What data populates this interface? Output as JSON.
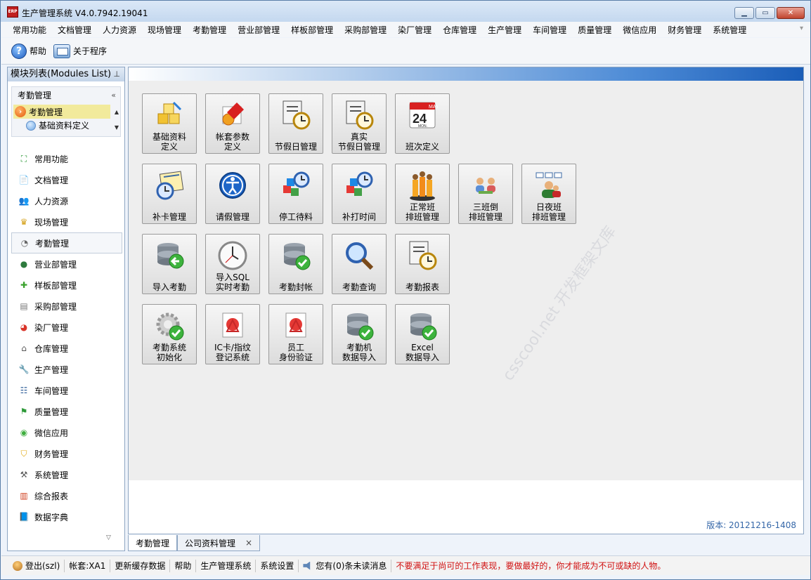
{
  "window": {
    "title": "生产管理系统 V4.0.7942.19041",
    "icon_text": "ERP",
    "minimize_icon": "minimize-icon",
    "maximize_icon": "maximize-icon",
    "close_icon": "close-icon"
  },
  "menubar": {
    "items": [
      "常用功能",
      "文档管理",
      "人力资源",
      "现场管理",
      "考勤管理",
      "营业部管理",
      "样板部管理",
      "采购部管理",
      "染厂管理",
      "仓库管理",
      "生产管理",
      "车间管理",
      "质量管理",
      "微信应用",
      "财务管理",
      "系统管理"
    ]
  },
  "toolbar": {
    "help_label": "帮助",
    "about_label": "关于程序"
  },
  "sidebar": {
    "title": "模块列表(Modules List)",
    "pin_icon": "pin-icon",
    "sub_panel": {
      "title": "考勤管理",
      "selected_item": "考勤管理",
      "child_item": "基础资料定义"
    },
    "nav_items": [
      {
        "label": "常用功能",
        "icon": "expand-icon",
        "glyph": "⛶",
        "color": "#2f9a3a"
      },
      {
        "label": "文档管理",
        "icon": "document-icon",
        "glyph": "📄",
        "color": "#5577aa"
      },
      {
        "label": "人力资源",
        "icon": "people-icon",
        "glyph": "👥",
        "color": "#8a5a2b"
      },
      {
        "label": "现场管理",
        "icon": "crown-icon",
        "glyph": "♛",
        "color": "#d4a017"
      },
      {
        "label": "考勤管理",
        "icon": "clock-icon",
        "glyph": "◔",
        "color": "#666666"
      },
      {
        "label": "营业部管理",
        "icon": "globe-icon",
        "glyph": "●",
        "color": "#2d7a3d"
      },
      {
        "label": "样板部管理",
        "icon": "puzzle-icon",
        "glyph": "✚",
        "color": "#39a12c"
      },
      {
        "label": "采购部管理",
        "icon": "newspaper-icon",
        "glyph": "▤",
        "color": "#777777"
      },
      {
        "label": "染厂管理",
        "icon": "pie-chart-icon",
        "glyph": "◕",
        "color": "#d9352a"
      },
      {
        "label": "仓库管理",
        "icon": "warehouse-icon",
        "glyph": "⌂",
        "color": "#555555"
      },
      {
        "label": "生产管理",
        "icon": "wrench-icon",
        "glyph": "🔧",
        "color": "#777777"
      },
      {
        "label": "车间管理",
        "icon": "hierarchy-icon",
        "glyph": "☷",
        "color": "#2f5f9a"
      },
      {
        "label": "质量管理",
        "icon": "flag-icon",
        "glyph": "⚑",
        "color": "#2f9a3a"
      },
      {
        "label": "微信应用",
        "icon": "wechat-icon",
        "glyph": "◉",
        "color": "#3fae3f"
      },
      {
        "label": "财务管理",
        "icon": "shield-icon",
        "glyph": "⛉",
        "color": "#e1a912"
      },
      {
        "label": "系统管理",
        "icon": "tools-icon",
        "glyph": "⚒",
        "color": "#555555"
      },
      {
        "label": "综合报表",
        "icon": "bar-chart-icon",
        "glyph": "▥",
        "color": "#d04020"
      },
      {
        "label": "数据字典",
        "icon": "book-icon",
        "glyph": "📘",
        "color": "#3a6fb5"
      }
    ]
  },
  "modules": [
    {
      "label": "基础资料\n定义",
      "icon": "blocks-icon"
    },
    {
      "label": "帐套参数\n定义",
      "icon": "settings-gear-icon"
    },
    {
      "label": "节假日管理",
      "icon": "document-clock-icon"
    },
    {
      "label": "真实\n节假日管理",
      "icon": "document-clock-icon"
    },
    {
      "label": "班次定义",
      "icon": "calendar-icon",
      "calendar_day": "24",
      "calendar_month": "MAY",
      "calendar_weekday": "MON."
    },
    {
      "label": "补卡管理",
      "icon": "calendar-clock-icon"
    },
    {
      "label": "请假管理",
      "icon": "accessibility-icon"
    },
    {
      "label": "停工待料",
      "icon": "cubes-clock-icon"
    },
    {
      "label": "补打时间",
      "icon": "cubes-clock-icon"
    },
    {
      "label": "正常班\n排班管理",
      "icon": "group-icon"
    },
    {
      "label": "三班倒\n排班管理",
      "icon": "team-icon"
    },
    {
      "label": "日夜班\n排班管理",
      "icon": "org-chart-icon"
    },
    {
      "label": "导入考勤",
      "icon": "database-import-icon"
    },
    {
      "label": "导入SQL\n实时考勤",
      "icon": "wall-clock-icon"
    },
    {
      "label": "考勤封帐",
      "icon": "database-check-icon"
    },
    {
      "label": "考勤查询",
      "icon": "magnifier-icon"
    },
    {
      "label": "考勤报表",
      "icon": "report-clock-icon"
    },
    {
      "label": "考勤系统\n初始化",
      "icon": "gear-check-icon"
    },
    {
      "label": "IC卡/指纹\n登记系统",
      "icon": "pdf-icon"
    },
    {
      "label": "员工\n身份验证",
      "icon": "pdf-icon"
    },
    {
      "label": "考勤机\n数据导入",
      "icon": "database-check-icon"
    },
    {
      "label": "Excel\n数据导入",
      "icon": "database-check-icon"
    }
  ],
  "version": "版本: 20121216-1408",
  "tabs": [
    {
      "label": "考勤管理",
      "active": true
    },
    {
      "label": "公司资料管理",
      "active": false,
      "close": "×"
    }
  ],
  "statusbar": {
    "login": "登出(szl)",
    "account": "帐套:XA1",
    "refresh": "更新缓存数据",
    "help": "帮助",
    "system": "生产管理系统",
    "settings": "系统设置",
    "messages": "您有(0)条未读消息",
    "motto": "不要满足于尚可的工作表现，要做最好的，你才能成为不可或缺的人物。"
  }
}
